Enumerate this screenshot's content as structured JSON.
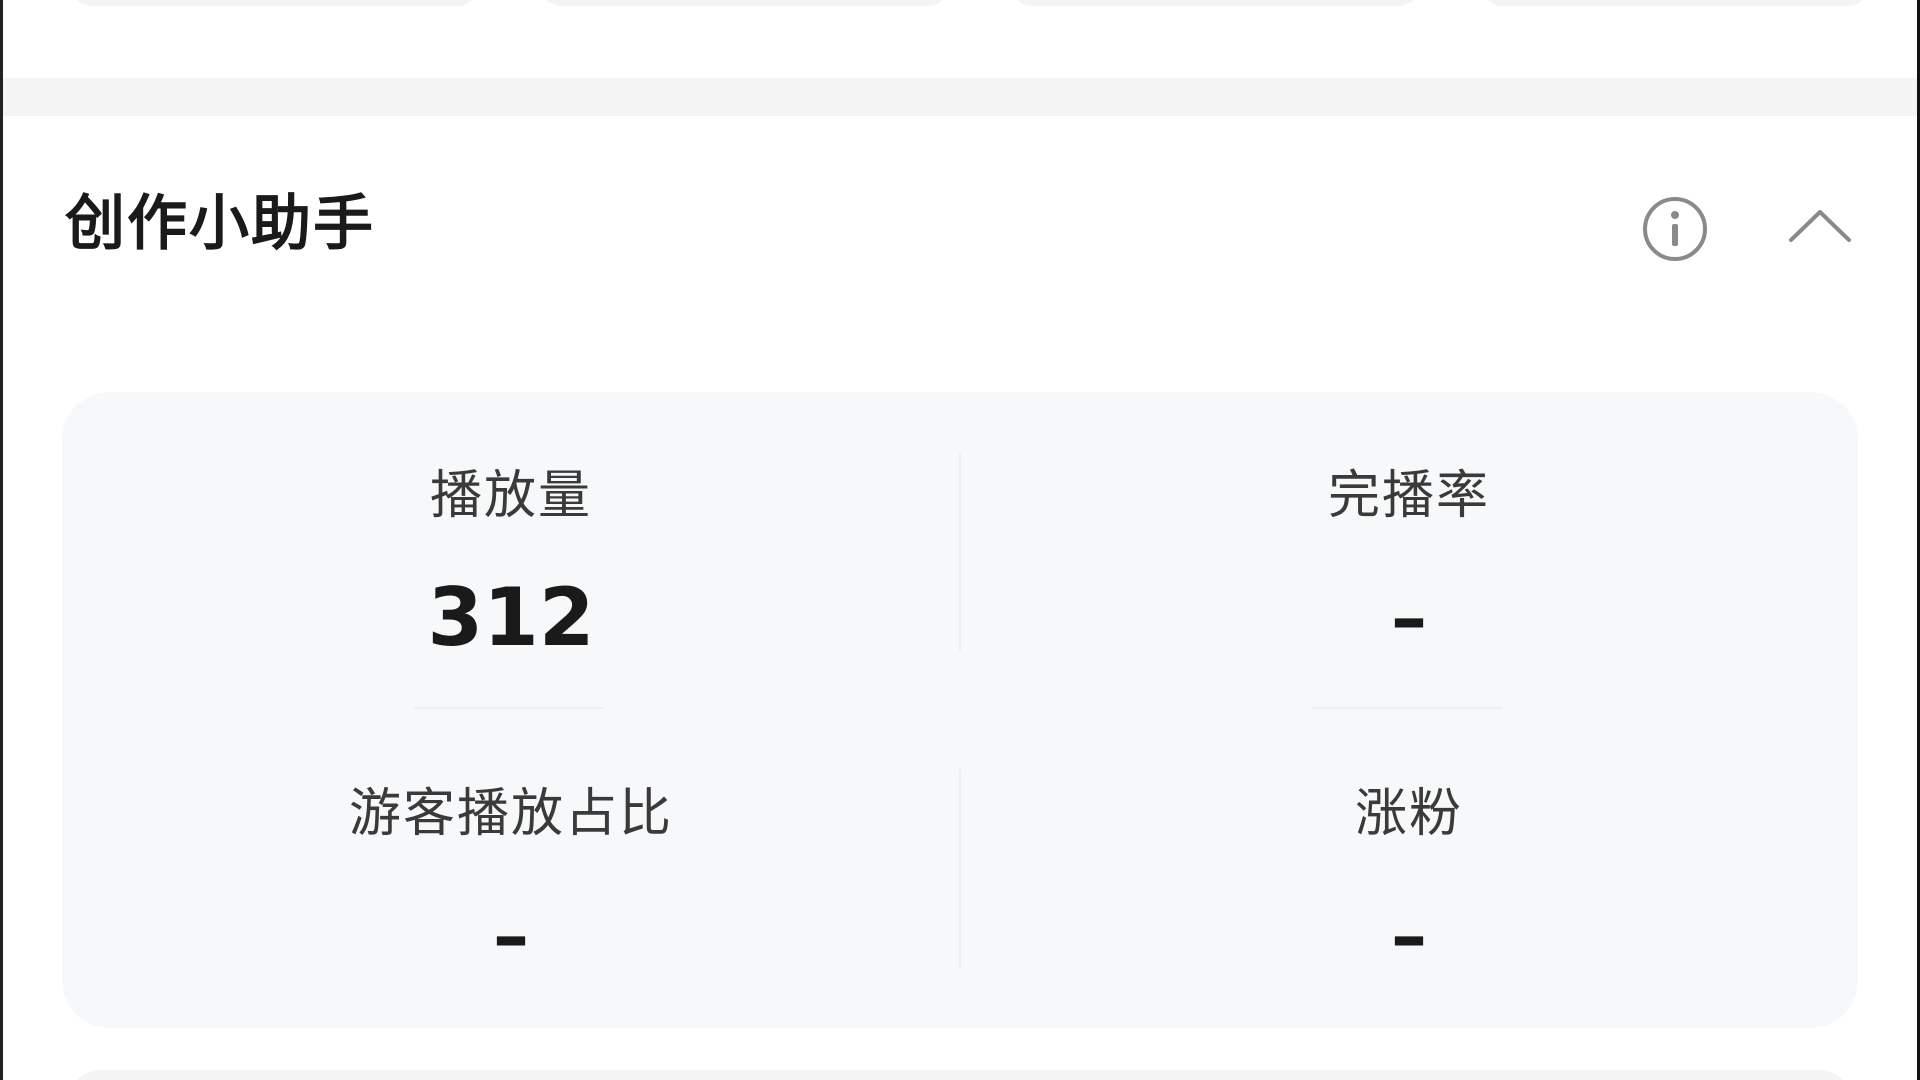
{
  "assistant": {
    "title": "创作小助手",
    "icons": {
      "info": "info-circle-icon",
      "collapse": "chevron-up-icon"
    }
  },
  "stats": [
    {
      "label": "播放量",
      "value": "312"
    },
    {
      "label": "完播率",
      "value": "–"
    },
    {
      "label": "游客播放占比",
      "value": "–"
    },
    {
      "label": "涨粉",
      "value": "–"
    }
  ],
  "colors": {
    "title_text": "#1a1a1a",
    "label_text": "#3a3a3a",
    "panel_background": "#f7f8f9",
    "separator_band": "#f4f4f5",
    "icon_stroke": "#8a8a8a"
  }
}
